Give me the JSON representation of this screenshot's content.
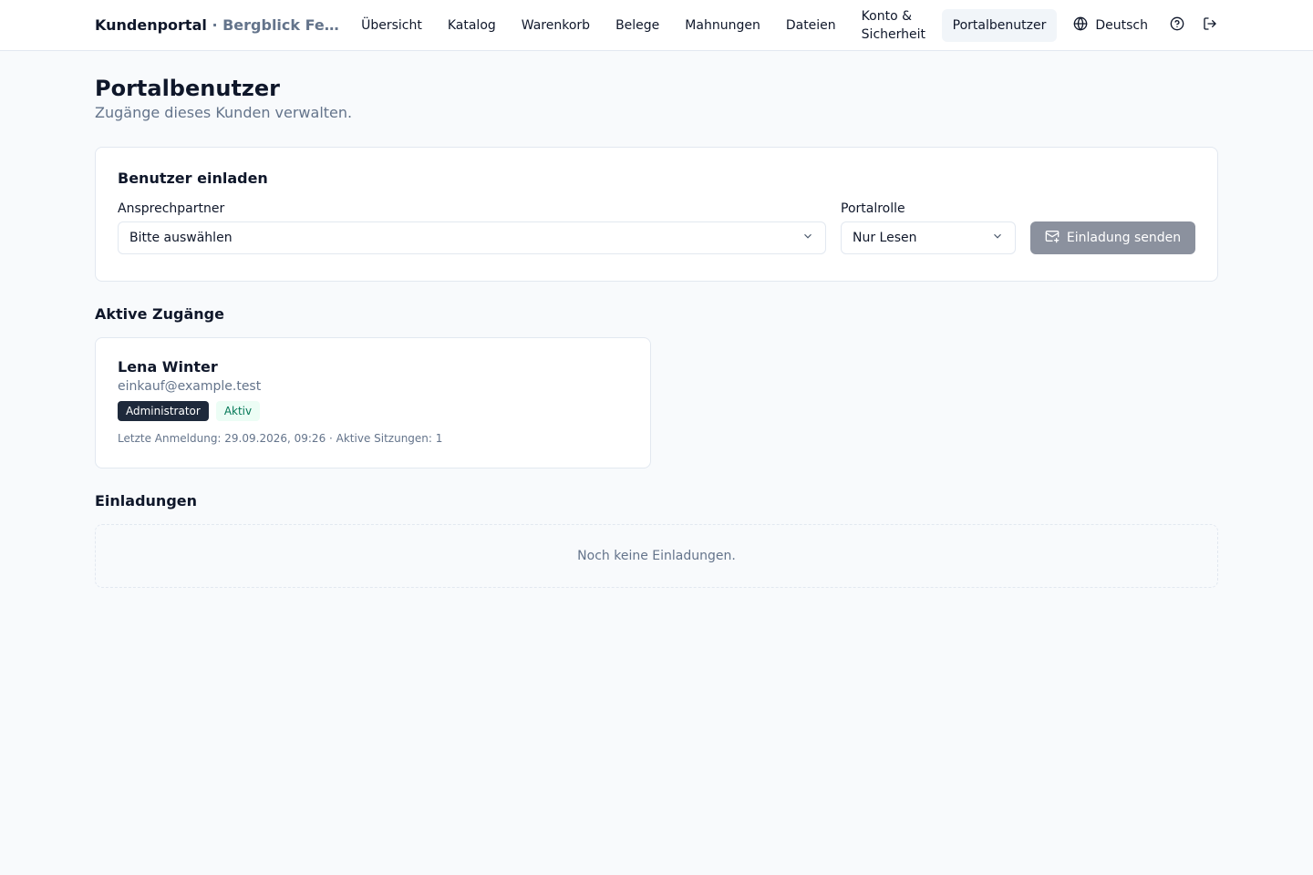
{
  "header": {
    "brand_name": "Kundenportal",
    "brand_separator": "·",
    "client_name": "Bergblick Fe...",
    "nav": [
      {
        "label": "Übersicht"
      },
      {
        "label": "Katalog"
      },
      {
        "label": "Warenkorb"
      },
      {
        "label": "Belege"
      },
      {
        "label": "Mahnungen"
      },
      {
        "label": "Dateien"
      },
      {
        "label": "Konto & Sicherheit"
      },
      {
        "label": "Portalbenutzer",
        "active": true
      }
    ],
    "language": "Deutsch",
    "icons": [
      "globe-icon",
      "help-icon",
      "logout-icon"
    ]
  },
  "page": {
    "title": "Portalbenutzer",
    "subtitle": "Zugänge dieses Kunden verwalten."
  },
  "invite": {
    "title": "Benutzer einladen",
    "partner_label": "Ansprechpartner",
    "partner_value": "Bitte auswählen",
    "role_label": "Portalrolle",
    "role_value": "Nur Lesen",
    "send_label": "Einladung senden"
  },
  "active_access": {
    "title": "Aktive Zugänge",
    "users": [
      {
        "name": "Lena Winter",
        "email": "einkauf@example.test",
        "role": "Administrator",
        "status": "Aktiv",
        "meta": "Letzte Anmeldung: 29.09.2026, 09:26 · Aktive Sitzungen: 1"
      }
    ]
  },
  "invitations": {
    "title": "Einladungen",
    "empty_text": "Noch keine Einladungen."
  }
}
